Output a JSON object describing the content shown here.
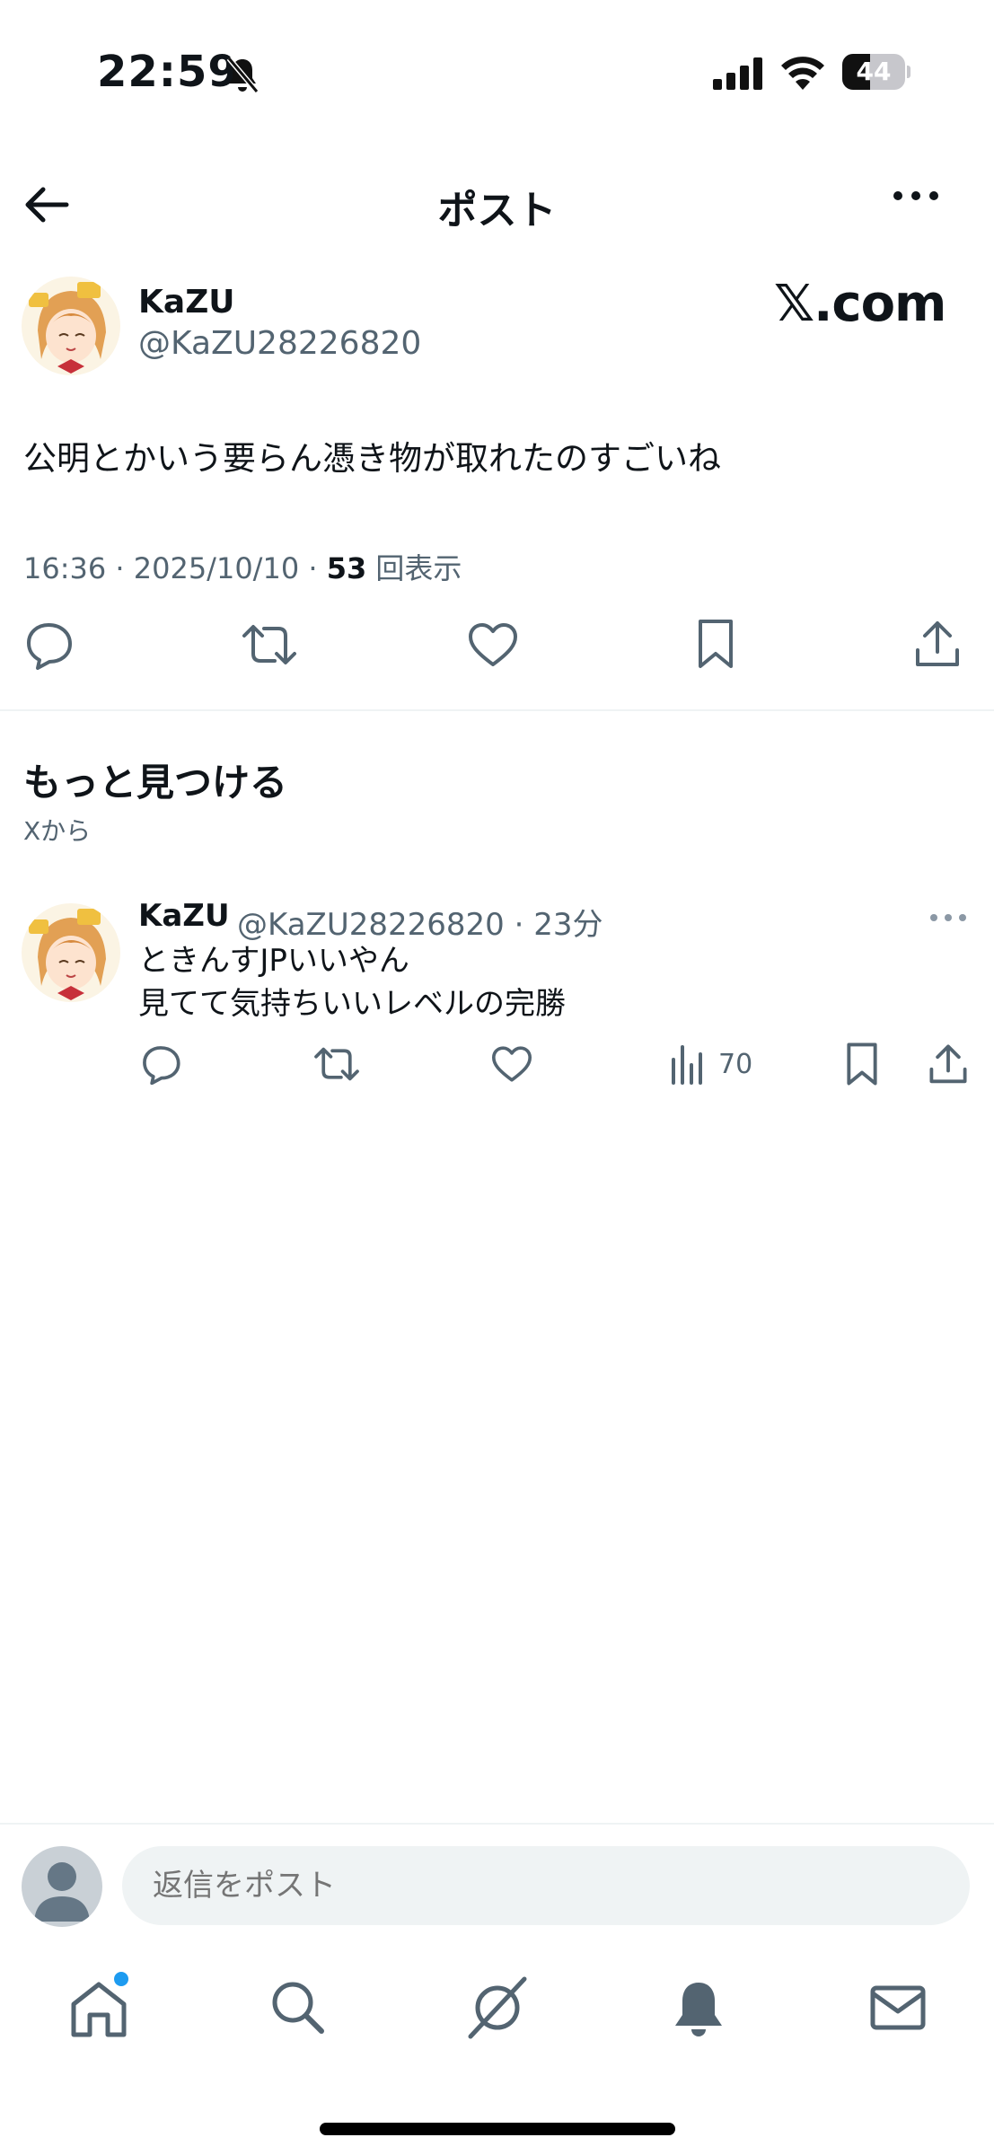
{
  "status_bar": {
    "time": "22:59",
    "battery": "44",
    "battery_level": 0.44
  },
  "header": {
    "title": "ポスト"
  },
  "post": {
    "author_name": "KaZU",
    "author_handle": "@KaZU28226820",
    "watermark": "𝕏.com",
    "text": "公明とかいう要らん憑き物が取れたのすごいね",
    "time": "16:36",
    "date": "2025/10/10",
    "views_count": "53",
    "views_label": "回表示"
  },
  "discover": {
    "title": "もっと見つける",
    "subtitle": "Xから"
  },
  "feed": [
    {
      "author_name": "KaZU",
      "meta": "@KaZU28226820 · 23分",
      "text_line1": "ときんすJPいいやん",
      "text_line2": "見てて気持ちいいレベルの完勝",
      "views": "70"
    }
  ],
  "reply": {
    "placeholder": "返信をポスト"
  },
  "icons": {
    "back": "back-arrow-icon",
    "more": "more-icon",
    "reply": "reply-icon",
    "repost": "repost-icon",
    "like": "like-icon",
    "bookmark": "bookmark-icon",
    "share": "share-icon",
    "views": "views-icon",
    "home": "home-icon",
    "search": "search-icon",
    "grok": "grok-icon",
    "notifications": "bell-icon",
    "messages": "mail-icon"
  },
  "colors": {
    "accent": "#1d9bf0",
    "text": "#0f1419",
    "secondary": "#536471"
  }
}
